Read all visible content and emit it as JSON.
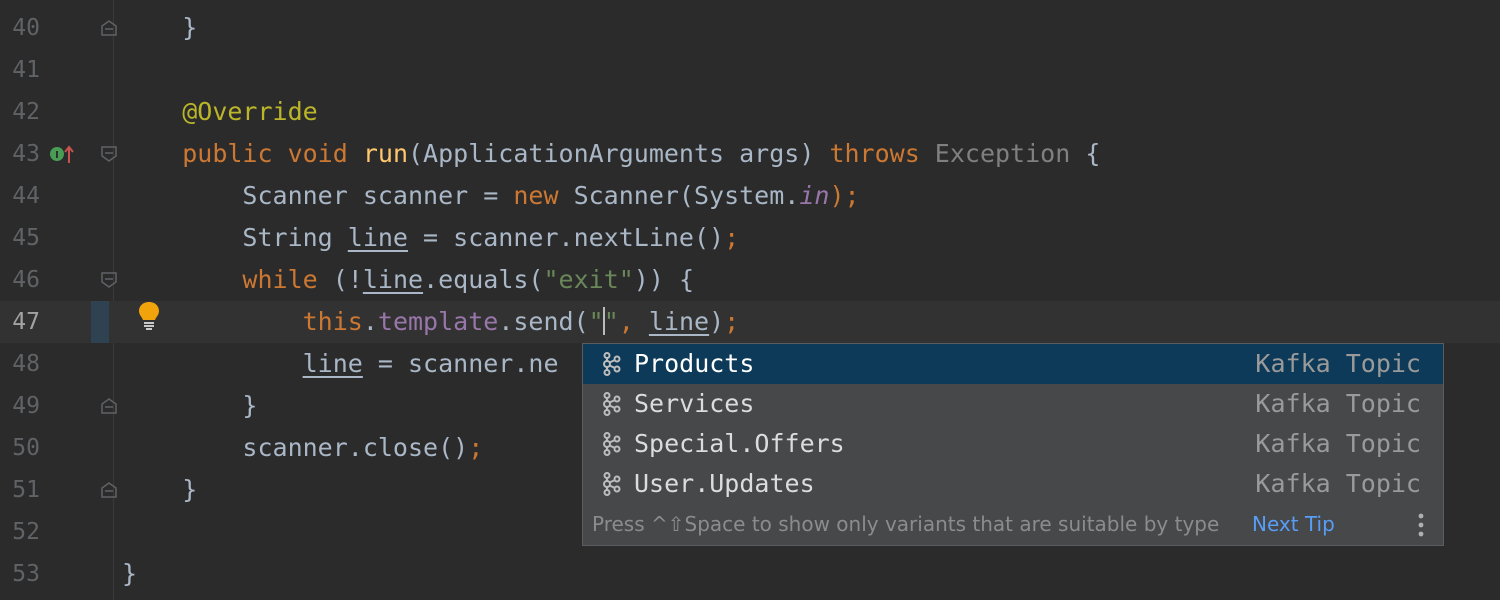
{
  "editor": {
    "lines": [
      {
        "num": "40",
        "code": "    }"
      },
      {
        "num": "41",
        "code": ""
      },
      {
        "num": "42",
        "code": "    @Override"
      },
      {
        "num": "43",
        "code": "    public void run(ApplicationArguments args) throws Exception {"
      },
      {
        "num": "44",
        "code": "        Scanner scanner = new Scanner(System.in);"
      },
      {
        "num": "45",
        "code": "        String line = scanner.nextLine();"
      },
      {
        "num": "46",
        "code": "        while (!line.equals(\"exit\")) {"
      },
      {
        "num": "47",
        "code": "            this.template.send(\"\", line);"
      },
      {
        "num": "48",
        "code": "            line = scanner.ne"
      },
      {
        "num": "49",
        "code": "        }"
      },
      {
        "num": "50",
        "code": "        scanner.close();"
      },
      {
        "num": "51",
        "code": "    }"
      },
      {
        "num": "52",
        "code": ""
      },
      {
        "num": "53",
        "code": "}"
      }
    ],
    "current_line": "47"
  },
  "completion": {
    "items": [
      {
        "name": "Products",
        "type": "Kafka Topic",
        "icon": "kafka-icon",
        "selected": true
      },
      {
        "name": "Services",
        "type": "Kafka Topic",
        "icon": "kafka-icon"
      },
      {
        "name": "Special.Offers",
        "type": "Kafka Topic",
        "icon": "kafka-icon"
      },
      {
        "name": "User.Updates",
        "type": "Kafka Topic",
        "icon": "kafka-icon"
      }
    ],
    "hint": "Press ^⇧Space to show only variants that are suitable by type",
    "next_tip": "Next Tip"
  },
  "colors": {
    "background": "#2b2b2b",
    "current_line": "#323232",
    "popup_bg": "#46484a",
    "popup_selected": "#0d3a58",
    "keyword": "#cc7832",
    "method": "#ffc66d",
    "annotation": "#bbb529",
    "string": "#6a8759",
    "field": "#9876aa",
    "link": "#589df6"
  }
}
